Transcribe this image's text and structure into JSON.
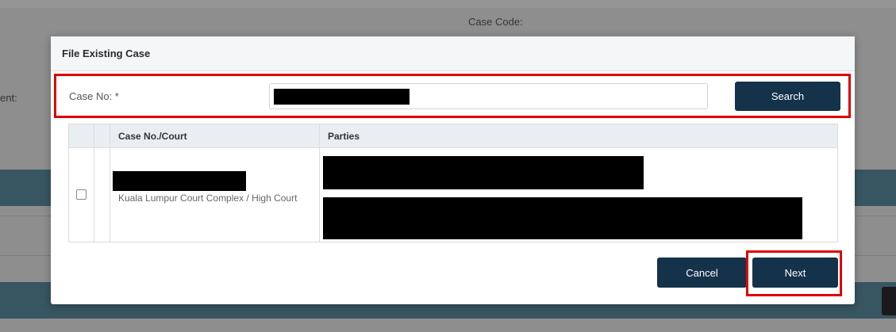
{
  "background": {
    "case_code_label": "Case Code:",
    "left_label": "ent:"
  },
  "modal": {
    "title": "File Existing Case",
    "case_no_label": "Case No: *",
    "case_no_value": "",
    "search_label": "Search",
    "table": {
      "headers": [
        "",
        "",
        "Case No./Court",
        "Parties"
      ],
      "rows": [
        {
          "court": "Kuala Lumpur Court Complex / High Court",
          "checked": false
        }
      ]
    },
    "cancel_label": "Cancel",
    "next_label": "Next"
  },
  "colors": {
    "primary_button": "#14324a",
    "highlight": "#e00000",
    "header_band": "#5b8a9f"
  }
}
